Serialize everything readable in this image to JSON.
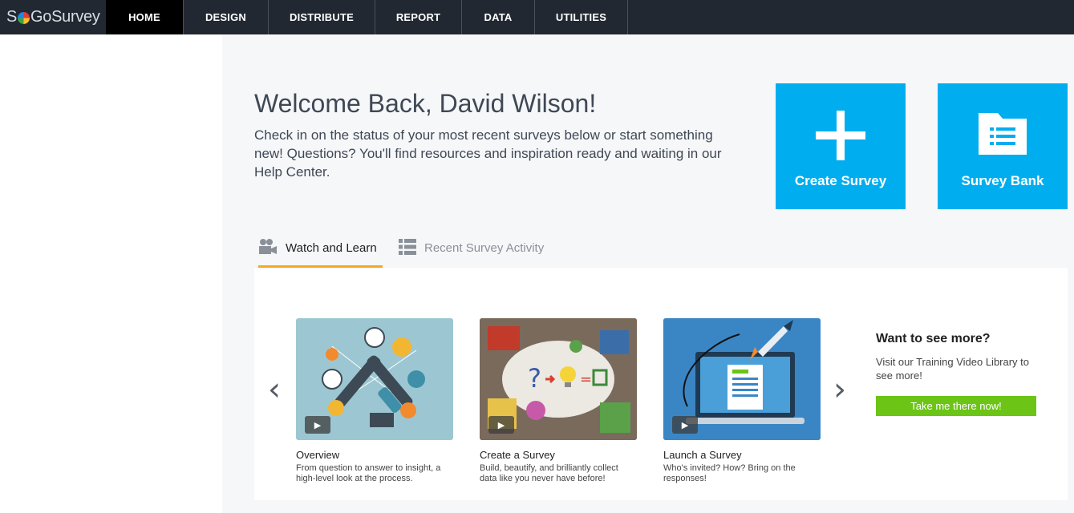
{
  "logo": {
    "text_before": "S",
    "text_after": "GoSurvey"
  },
  "nav": {
    "tabs": [
      {
        "label": "HOME",
        "active": true
      },
      {
        "label": "DESIGN",
        "active": false
      },
      {
        "label": "DISTRIBUTE",
        "active": false
      },
      {
        "label": "REPORT",
        "active": false
      },
      {
        "label": "DATA",
        "active": false
      },
      {
        "label": "UTILITIES",
        "active": false
      }
    ]
  },
  "welcome": {
    "title": "Welcome Back, David Wilson!",
    "text": "Check in on the status of your most recent surveys below or start something new! Questions? You'll find resources and inspiration ready and waiting in our Help Center."
  },
  "tiles": {
    "create": {
      "label": "Create Survey",
      "icon": "plus-icon"
    },
    "bank": {
      "label": "Survey Bank",
      "icon": "folder-list-icon"
    }
  },
  "tabs": {
    "watch": {
      "label": "Watch and Learn",
      "icon": "video-camera-icon",
      "active": true
    },
    "recent": {
      "label": "Recent Survey Activity",
      "icon": "list-icon",
      "active": false
    }
  },
  "videos": [
    {
      "title": "Overview",
      "desc": "From question to answer to insight, a high-level look at the process."
    },
    {
      "title": "Create a Survey",
      "desc": "Build, beautify, and brilliantly collect data like you never have before!"
    },
    {
      "title": "Launch a Survey",
      "desc": "Who's invited? How? Bring on the responses!"
    }
  ],
  "more": {
    "title": "Want to see more?",
    "text": "Visit our Training Video Library to see more!",
    "button": "Take me there now!"
  },
  "colors": {
    "nav_bg": "#222831",
    "accent_blue": "#00aeef",
    "tab_underline": "#f5a623",
    "button_green": "#6cc417"
  }
}
